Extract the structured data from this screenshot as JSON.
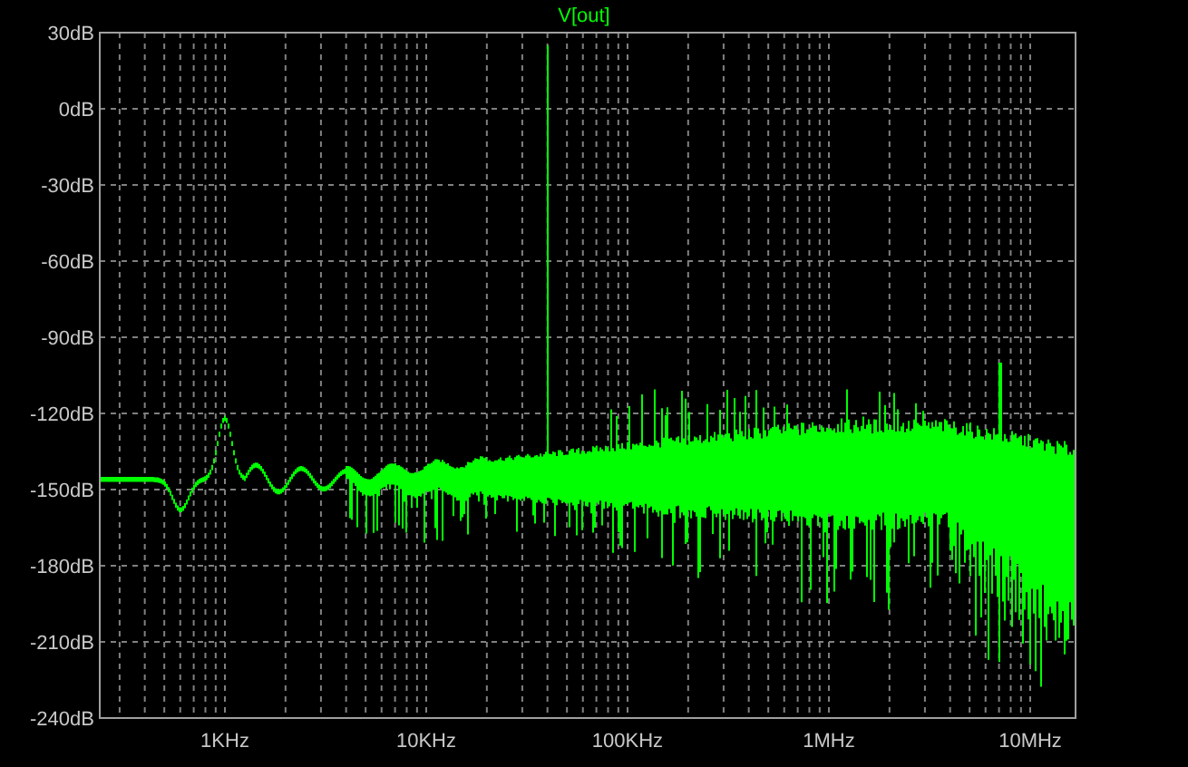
{
  "trace": {
    "label": "V[out]"
  },
  "y_axis": {
    "ticks": [
      "30dB",
      "0dB",
      "-30dB",
      "-60dB",
      "-90dB",
      "-120dB",
      "-150dB",
      "-180dB",
      "-210dB",
      "-240dB"
    ]
  },
  "x_axis": {
    "ticks": [
      "1KHz",
      "10KHz",
      "100KHz",
      "1MHz",
      "10MHz"
    ]
  }
}
